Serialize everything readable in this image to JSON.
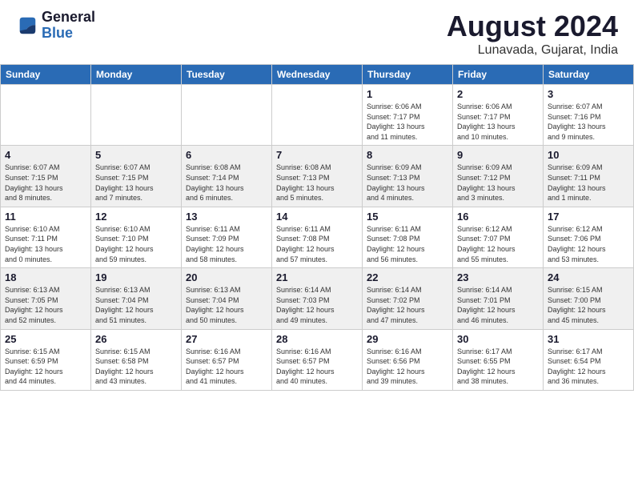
{
  "header": {
    "logo": {
      "general": "General",
      "blue": "Blue"
    },
    "title": "August 2024",
    "subtitle": "Lunavada, Gujarat, India"
  },
  "calendar": {
    "weekdays": [
      "Sunday",
      "Monday",
      "Tuesday",
      "Wednesday",
      "Thursday",
      "Friday",
      "Saturday"
    ],
    "weeks": [
      [
        {
          "day": "",
          "info": ""
        },
        {
          "day": "",
          "info": ""
        },
        {
          "day": "",
          "info": ""
        },
        {
          "day": "",
          "info": ""
        },
        {
          "day": "1",
          "info": "Sunrise: 6:06 AM\nSunset: 7:17 PM\nDaylight: 13 hours\nand 11 minutes."
        },
        {
          "day": "2",
          "info": "Sunrise: 6:06 AM\nSunset: 7:17 PM\nDaylight: 13 hours\nand 10 minutes."
        },
        {
          "day": "3",
          "info": "Sunrise: 6:07 AM\nSunset: 7:16 PM\nDaylight: 13 hours\nand 9 minutes."
        }
      ],
      [
        {
          "day": "4",
          "info": "Sunrise: 6:07 AM\nSunset: 7:15 PM\nDaylight: 13 hours\nand 8 minutes."
        },
        {
          "day": "5",
          "info": "Sunrise: 6:07 AM\nSunset: 7:15 PM\nDaylight: 13 hours\nand 7 minutes."
        },
        {
          "day": "6",
          "info": "Sunrise: 6:08 AM\nSunset: 7:14 PM\nDaylight: 13 hours\nand 6 minutes."
        },
        {
          "day": "7",
          "info": "Sunrise: 6:08 AM\nSunset: 7:13 PM\nDaylight: 13 hours\nand 5 minutes."
        },
        {
          "day": "8",
          "info": "Sunrise: 6:09 AM\nSunset: 7:13 PM\nDaylight: 13 hours\nand 4 minutes."
        },
        {
          "day": "9",
          "info": "Sunrise: 6:09 AM\nSunset: 7:12 PM\nDaylight: 13 hours\nand 3 minutes."
        },
        {
          "day": "10",
          "info": "Sunrise: 6:09 AM\nSunset: 7:11 PM\nDaylight: 13 hours\nand 1 minute."
        }
      ],
      [
        {
          "day": "11",
          "info": "Sunrise: 6:10 AM\nSunset: 7:11 PM\nDaylight: 13 hours\nand 0 minutes."
        },
        {
          "day": "12",
          "info": "Sunrise: 6:10 AM\nSunset: 7:10 PM\nDaylight: 12 hours\nand 59 minutes."
        },
        {
          "day": "13",
          "info": "Sunrise: 6:11 AM\nSunset: 7:09 PM\nDaylight: 12 hours\nand 58 minutes."
        },
        {
          "day": "14",
          "info": "Sunrise: 6:11 AM\nSunset: 7:08 PM\nDaylight: 12 hours\nand 57 minutes."
        },
        {
          "day": "15",
          "info": "Sunrise: 6:11 AM\nSunset: 7:08 PM\nDaylight: 12 hours\nand 56 minutes."
        },
        {
          "day": "16",
          "info": "Sunrise: 6:12 AM\nSunset: 7:07 PM\nDaylight: 12 hours\nand 55 minutes."
        },
        {
          "day": "17",
          "info": "Sunrise: 6:12 AM\nSunset: 7:06 PM\nDaylight: 12 hours\nand 53 minutes."
        }
      ],
      [
        {
          "day": "18",
          "info": "Sunrise: 6:13 AM\nSunset: 7:05 PM\nDaylight: 12 hours\nand 52 minutes."
        },
        {
          "day": "19",
          "info": "Sunrise: 6:13 AM\nSunset: 7:04 PM\nDaylight: 12 hours\nand 51 minutes."
        },
        {
          "day": "20",
          "info": "Sunrise: 6:13 AM\nSunset: 7:04 PM\nDaylight: 12 hours\nand 50 minutes."
        },
        {
          "day": "21",
          "info": "Sunrise: 6:14 AM\nSunset: 7:03 PM\nDaylight: 12 hours\nand 49 minutes."
        },
        {
          "day": "22",
          "info": "Sunrise: 6:14 AM\nSunset: 7:02 PM\nDaylight: 12 hours\nand 47 minutes."
        },
        {
          "day": "23",
          "info": "Sunrise: 6:14 AM\nSunset: 7:01 PM\nDaylight: 12 hours\nand 46 minutes."
        },
        {
          "day": "24",
          "info": "Sunrise: 6:15 AM\nSunset: 7:00 PM\nDaylight: 12 hours\nand 45 minutes."
        }
      ],
      [
        {
          "day": "25",
          "info": "Sunrise: 6:15 AM\nSunset: 6:59 PM\nDaylight: 12 hours\nand 44 minutes."
        },
        {
          "day": "26",
          "info": "Sunrise: 6:15 AM\nSunset: 6:58 PM\nDaylight: 12 hours\nand 43 minutes."
        },
        {
          "day": "27",
          "info": "Sunrise: 6:16 AM\nSunset: 6:57 PM\nDaylight: 12 hours\nand 41 minutes."
        },
        {
          "day": "28",
          "info": "Sunrise: 6:16 AM\nSunset: 6:57 PM\nDaylight: 12 hours\nand 40 minutes."
        },
        {
          "day": "29",
          "info": "Sunrise: 6:16 AM\nSunset: 6:56 PM\nDaylight: 12 hours\nand 39 minutes."
        },
        {
          "day": "30",
          "info": "Sunrise: 6:17 AM\nSunset: 6:55 PM\nDaylight: 12 hours\nand 38 minutes."
        },
        {
          "day": "31",
          "info": "Sunrise: 6:17 AM\nSunset: 6:54 PM\nDaylight: 12 hours\nand 36 minutes."
        }
      ]
    ]
  }
}
